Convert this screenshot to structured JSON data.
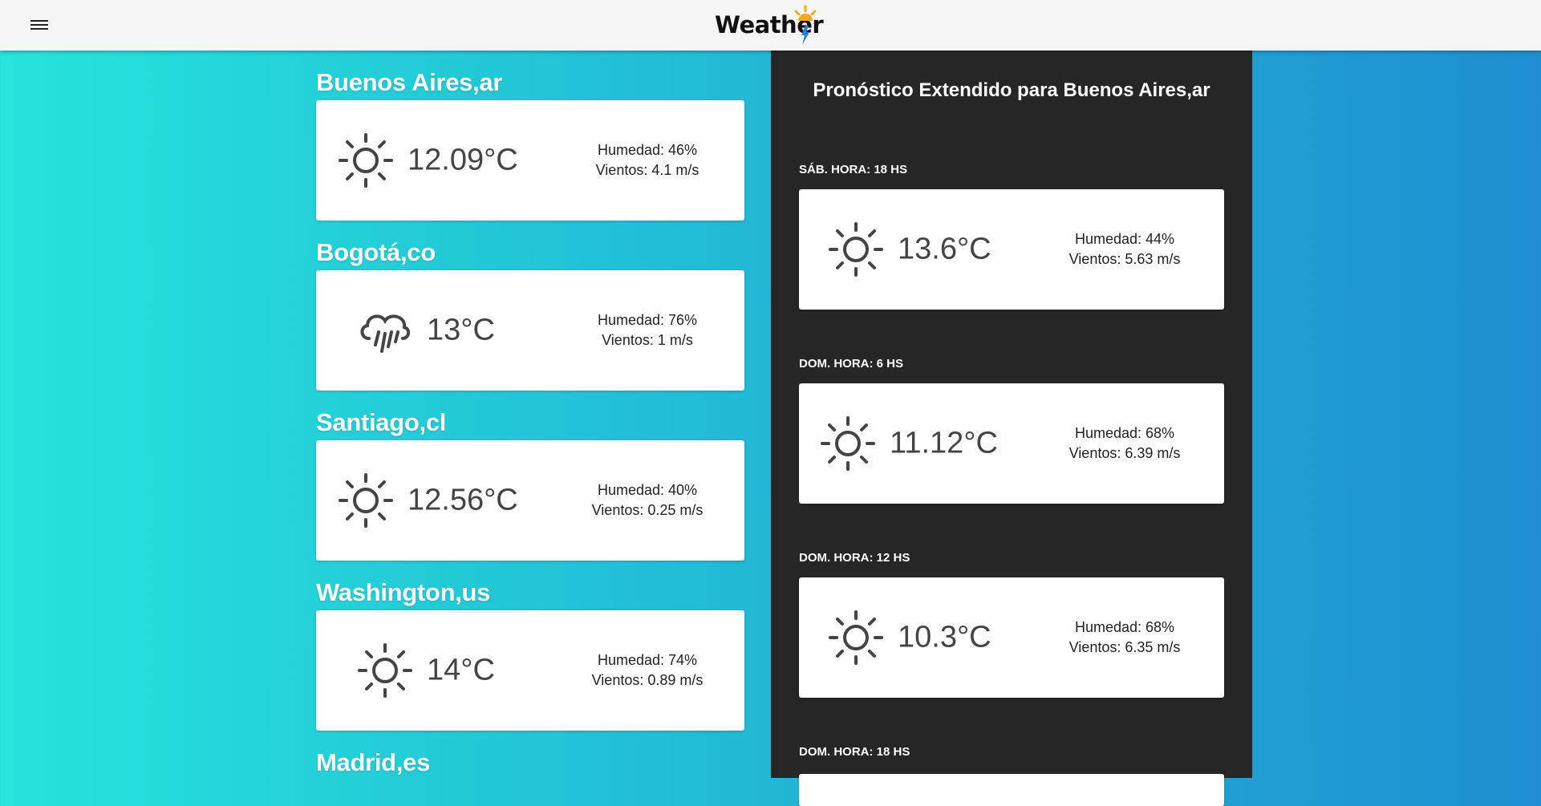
{
  "header": {
    "menu_icon": "menu-icon",
    "logo_text": "Weather",
    "logo_icon": "sun-lightning-icon"
  },
  "cities": [
    {
      "name": "Buenos Aires,ar",
      "icon": "sun-icon",
      "temp": "12.09°C",
      "humidity": "Humedad: 46%",
      "wind": "Vientos: 4.1 m/s"
    },
    {
      "name": "Bogotá,co",
      "icon": "rain-cloud-icon",
      "temp": "13°C",
      "humidity": "Humedad: 76%",
      "wind": "Vientos: 1 m/s"
    },
    {
      "name": "Santiago,cl",
      "icon": "sun-icon",
      "temp": "12.56°C",
      "humidity": "Humedad: 40%",
      "wind": "Vientos: 0.25 m/s"
    },
    {
      "name": "Washington,us",
      "icon": "sun-icon",
      "temp": "14°C",
      "humidity": "Humedad: 74%",
      "wind": "Vientos: 0.89 m/s"
    },
    {
      "name": "Madrid,es"
    }
  ],
  "forecast": {
    "title": "Pronóstico Extendido para Buenos Aires,ar",
    "items": [
      {
        "label": "SÁB. HORA: 18 HS",
        "icon": "sun-icon",
        "temp": "13.6°C",
        "humidity": "Humedad: 44%",
        "wind": "Vientos: 5.63 m/s"
      },
      {
        "label": "DOM. HORA: 6 HS",
        "icon": "sun-icon",
        "temp": "11.12°C",
        "humidity": "Humedad: 68%",
        "wind": "Vientos: 6.39 m/s"
      },
      {
        "label": "DOM. HORA: 12 HS",
        "icon": "sun-icon",
        "temp": "10.3°C",
        "humidity": "Humedad: 68%",
        "wind": "Vientos: 6.35 m/s"
      },
      {
        "label": "DOM. HORA: 18 HS"
      }
    ]
  }
}
